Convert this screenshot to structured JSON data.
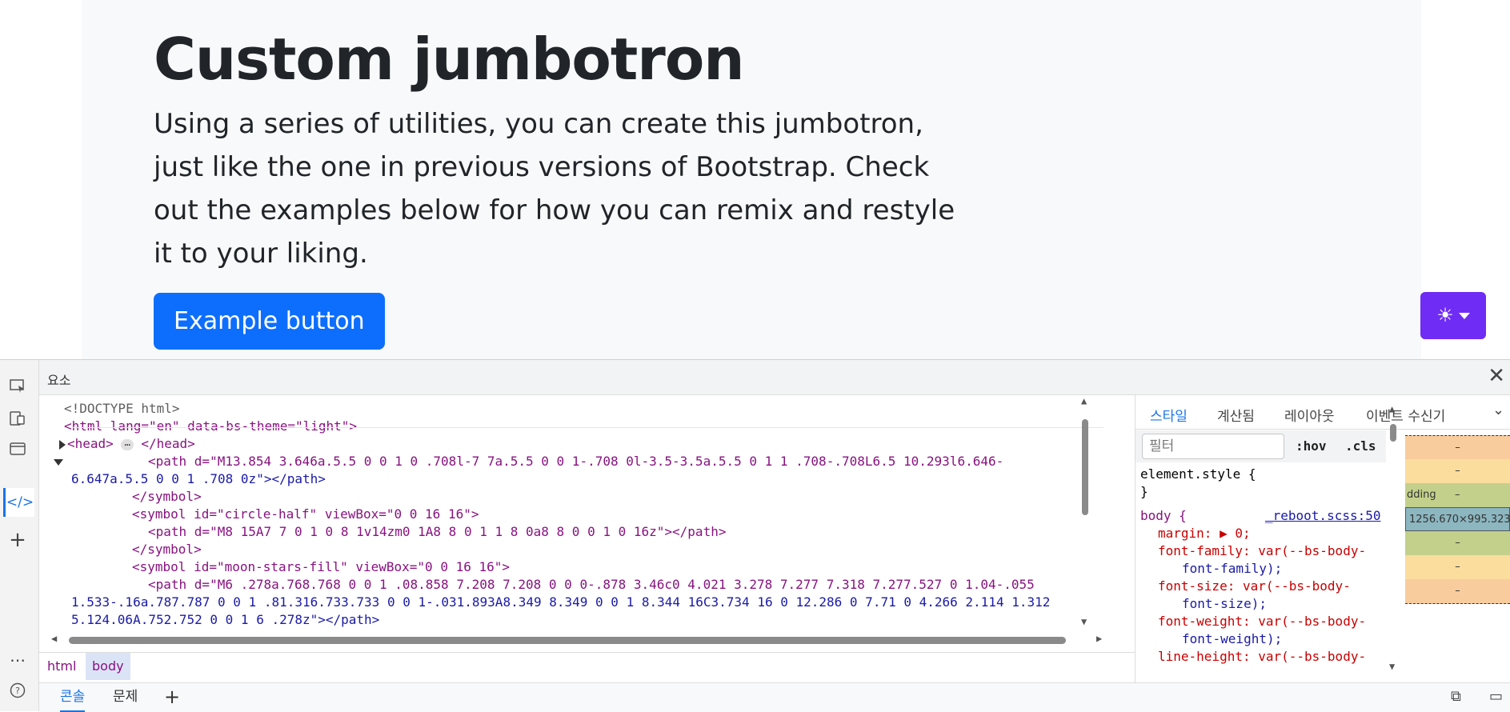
{
  "jumbotron": {
    "title": "Custom jumbotron",
    "lead": "Using a series of utilities, you can create this jumbotron, just like the one in previous versions of Bootstrap. Check out the examples below for how you can remix and restyle it to your liking.",
    "button": "Example button"
  },
  "theme_toggle": {
    "icon": "☀"
  },
  "devtools": {
    "panel_title": "요소",
    "close": "✕",
    "code_lines": [
      {
        "text": "<!DOCTYPE html>"
      },
      {
        "text": "<html lang=\"en\" data-bs-theme=\"light\">"
      },
      {
        "text": "<head>"
      },
      {
        "text": "</head>"
      },
      {
        "text": "<path d=\"M13.854 3.646a.5.5 0 0 1 0 .708l-7 7a.5.5 0 0 1-.708 0l-3.5-3.5a.5.5 0 1 1 .708-.708L6.5 10.293l6.646-"
      },
      {
        "text": "6.647a.5.5 0 0 1 .708 0z\"></path>"
      },
      {
        "text": "</symbol>"
      },
      {
        "text": "<symbol id=\"circle-half\" viewBox=\"0 0 16 16\">"
      },
      {
        "text": "<path d=\"M8 15A7 7 0 1 0 8 1v14zm0 1A8 8 0 1 1 8 0a8 8 0 0 1 0 16z\"></path>"
      },
      {
        "text": "</symbol>"
      },
      {
        "text": "<symbol id=\"moon-stars-fill\" viewBox=\"0 0 16 16\">"
      },
      {
        "text": "<path d=\"M6 .278a.768.768 0 0 1 .08.858 7.208 7.208 0 0 0-.878 3.46c0 4.021 3.278 7.277 7.318 7.277.527 0 1.04-.055"
      },
      {
        "text": "1.533-.16a.787.787 0 0 1 .81.316.733.733 0 0 1-.031.893A8.349 8.349 0 0 1 8.344 16C3.734 16 0 12.286 0 7.71 0 4.266 2.114 1.312"
      },
      {
        "text": "5.124.06A.752.752 0 0 1 6 .278z\"></path>"
      }
    ],
    "breadcrumbs": [
      "html",
      "body"
    ],
    "bottom_tabs": [
      "콘솔",
      "문제",
      "+"
    ],
    "styles_tabs": [
      "스타일",
      "계산됨",
      "레이아웃",
      "이벤트 수신기"
    ],
    "filter_placeholder": "필터",
    "hov": ":hov",
    "cls": ".cls",
    "rules": {
      "element_style": "element.style {",
      "close_brace": "}",
      "body_selector": "body {",
      "body_source": "_reboot.scss:50",
      "margin": "margin: ▶ 0;",
      "font_family_1": "font-family: var(--bs-body-",
      "font_family_2": "font-family);",
      "font_size_1": "font-size: var(--bs-body-",
      "font_size_2": "font-size);",
      "font_weight_1": "font-weight: var(--bs-body-",
      "font_weight_2": "font-weight);",
      "line_height_1": "line-height: var(--bs-body-"
    },
    "box_model": {
      "dash": "–",
      "padding_label": "dding",
      "size": "1256.670×995.323"
    }
  }
}
